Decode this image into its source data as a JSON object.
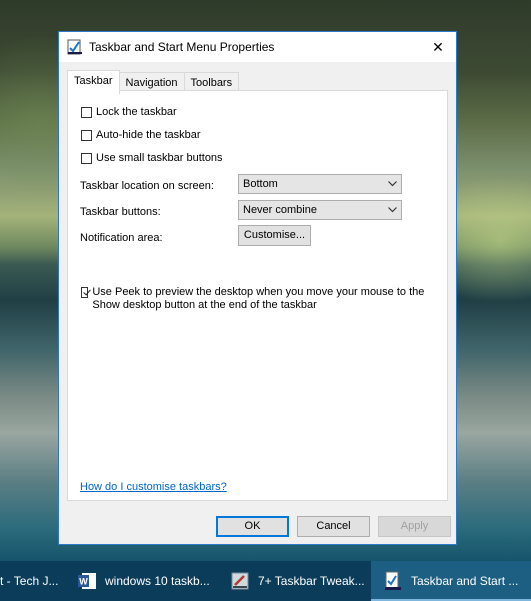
{
  "window": {
    "title": "Taskbar and Start Menu Properties",
    "close_glyph": "✕",
    "tabs": [
      {
        "label": "Taskbar"
      },
      {
        "label": "Navigation"
      },
      {
        "label": "Toolbars"
      }
    ],
    "options": {
      "lock": {
        "label": "Lock the taskbar",
        "checked": false
      },
      "autohide": {
        "label": "Auto-hide the taskbar",
        "checked": false
      },
      "small_buttons": {
        "label": "Use small taskbar buttons",
        "checked": false
      },
      "location": {
        "label": "Taskbar location on screen:",
        "value": "Bottom"
      },
      "buttons": {
        "label": "Taskbar buttons:",
        "value": "Never combine"
      },
      "notification": {
        "label": "Notification area:",
        "button_label": "Customise..."
      },
      "peek": {
        "label": "Use Peek to preview the desktop when you move your mouse to the Show desktop button at the end of the taskbar",
        "checked": true
      }
    },
    "help_link": "How do I customise taskbars?",
    "footer": {
      "ok": "OK",
      "cancel": "Cancel",
      "apply": "Apply"
    }
  },
  "taskbar": {
    "items": [
      {
        "label": "t - Tech J...",
        "icon": "browser-icon"
      },
      {
        "label": "windows 10 taskb...",
        "icon": "word-icon"
      },
      {
        "label": "7+ Taskbar Tweak...",
        "icon": "taskbar-tweaker-icon"
      },
      {
        "label": "Taskbar and Start ...",
        "icon": "taskbar-properties-icon"
      }
    ]
  },
  "colors": {
    "accent": "#0078d7",
    "taskbar": "#0b3d5a",
    "link": "#0066cc"
  }
}
